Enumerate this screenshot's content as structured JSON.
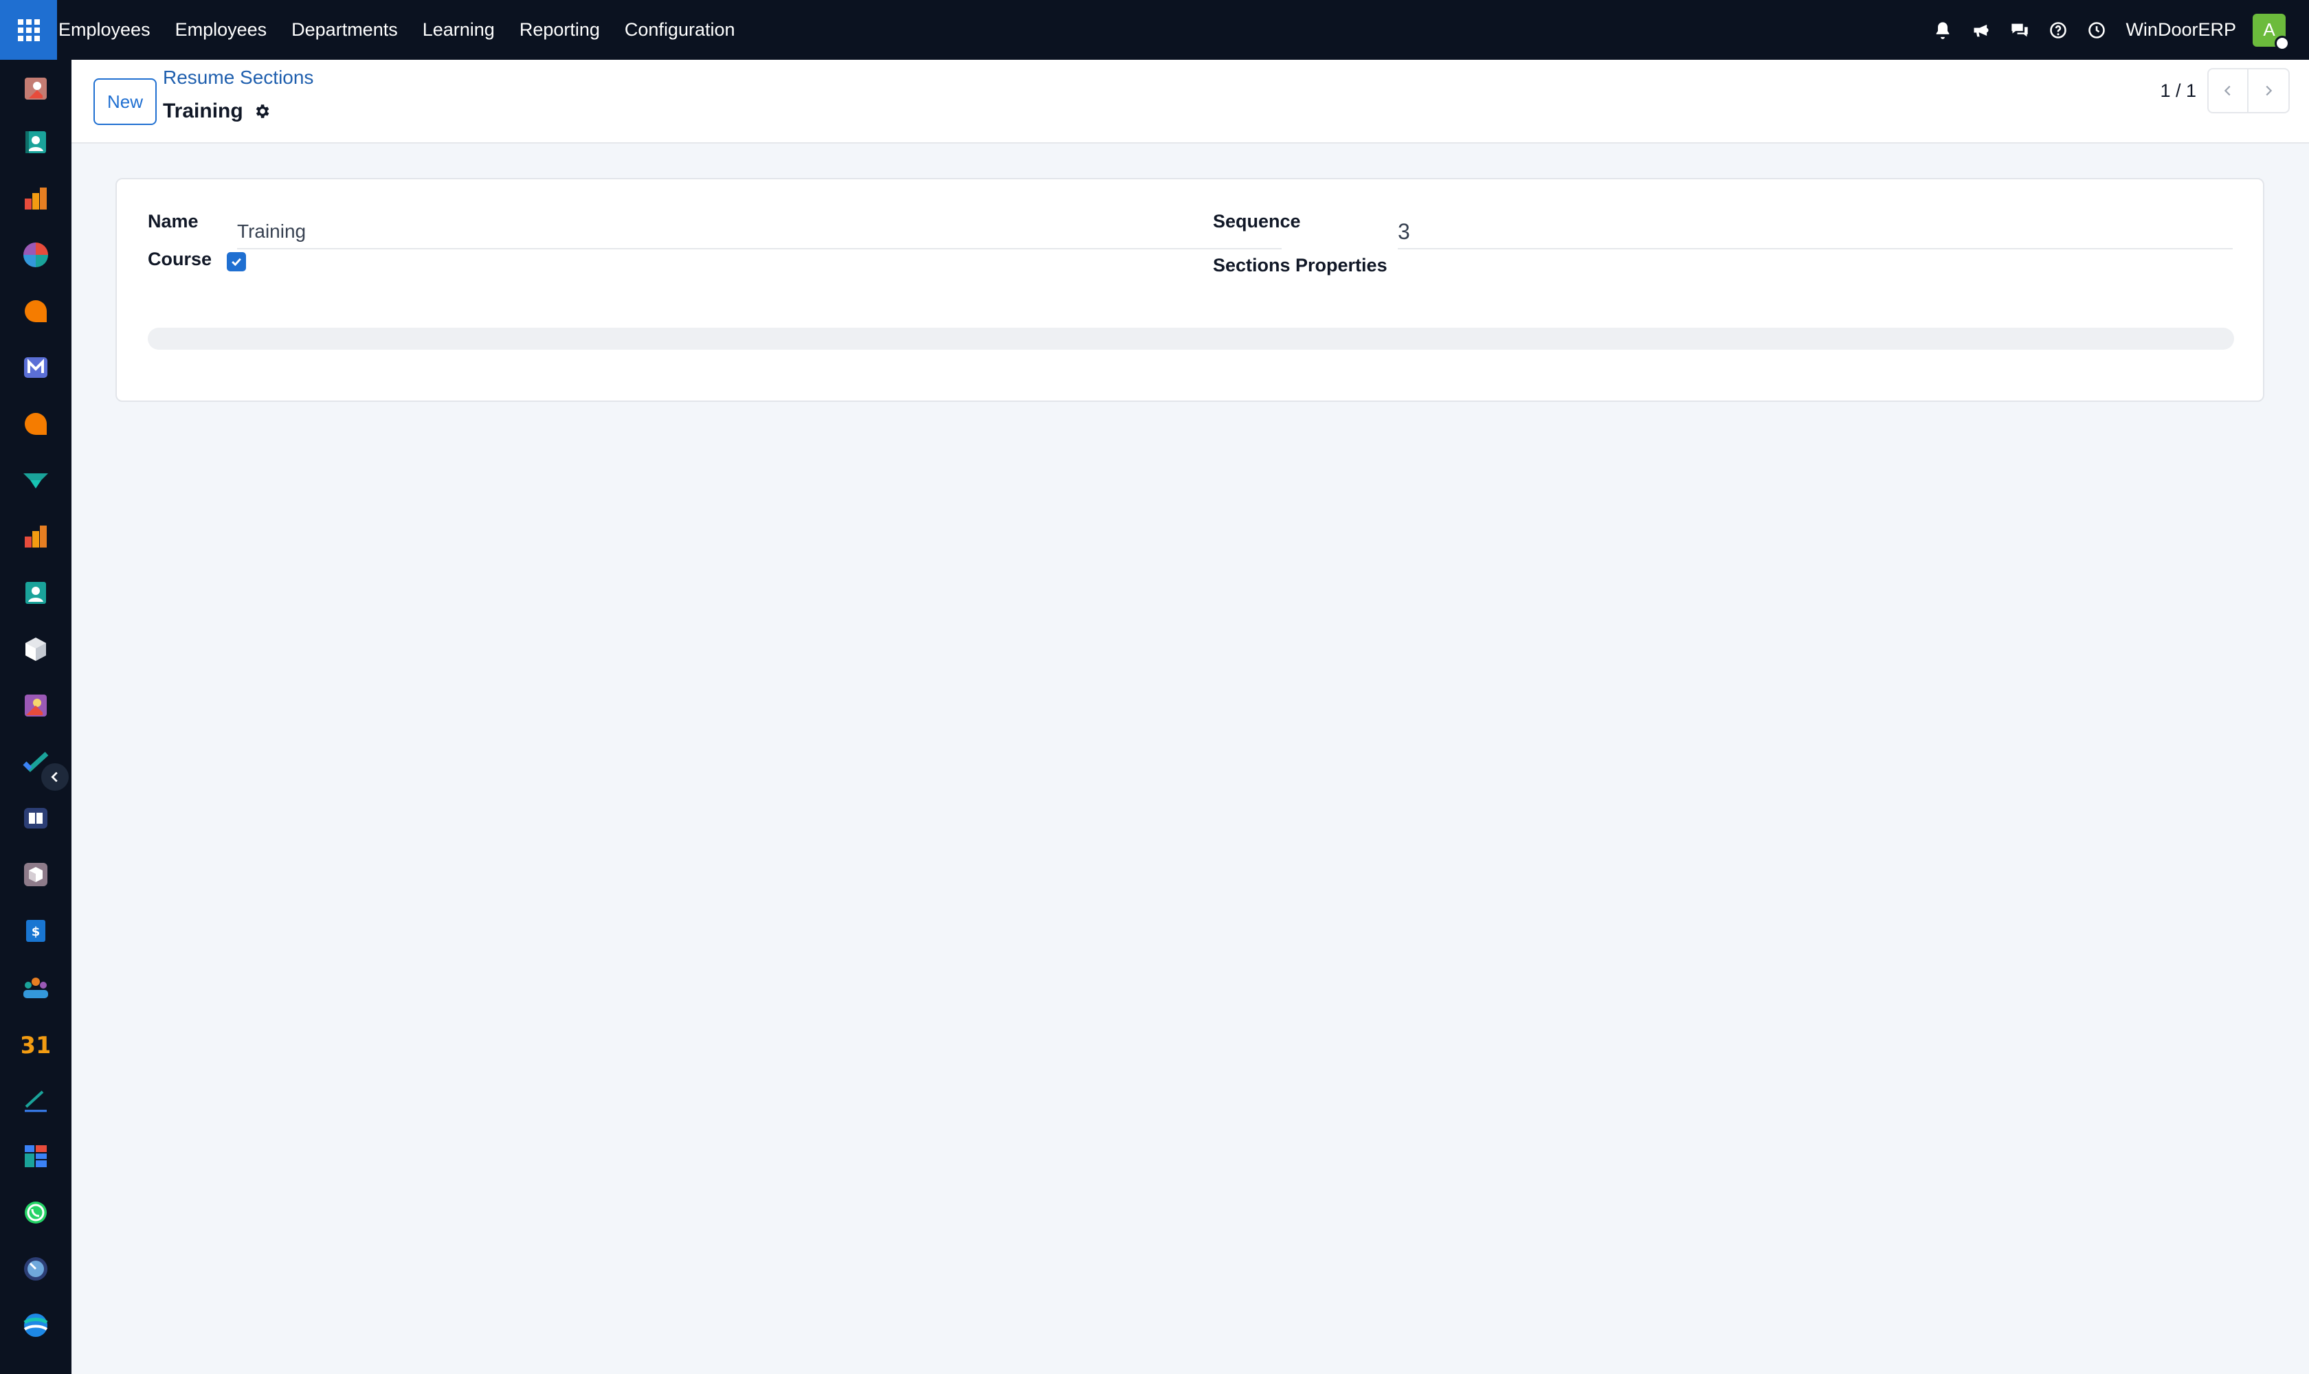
{
  "navbar": {
    "app_name": "Employees",
    "menu": [
      "Employees",
      "Departments",
      "Learning",
      "Reporting",
      "Configuration"
    ],
    "tray_icons": [
      "bell-icon",
      "megaphone-icon",
      "chat-icon",
      "help-icon",
      "clock-icon"
    ],
    "company": "WinDoorERP",
    "avatar_letter": "A",
    "avatar_color": "#6cbb3c"
  },
  "sidebar": {
    "apps": [
      "employees-app-icon",
      "contacts-app-icon",
      "reporting-app-icon",
      "dashboards-app-icon",
      "discuss-app-icon",
      "email-marketing-app-icon",
      "livechat-app-icon",
      "project-app-icon",
      "analytics-app-icon",
      "directory-app-icon",
      "inventory-app-icon",
      "employees-alt-app-icon",
      "todo-app-icon",
      "knowledge-app-icon",
      "purchase-app-icon",
      "expenses-app-icon",
      "team-app-icon",
      "calendar-app-icon",
      "sign-app-icon",
      "spreadsheet-app-icon",
      "whatsapp-app-icon",
      "time-off-app-icon",
      "website-app-icon"
    ]
  },
  "control_panel": {
    "new_label": "New",
    "breadcrumb_parent": "Resume Sections",
    "breadcrumb_current": "Training",
    "pager_value": "1 / 1"
  },
  "form": {
    "name_label": "Name",
    "name_value": "Training",
    "course_label": "Course",
    "course_checked": true,
    "sequence_label": "Sequence",
    "sequence_value": "3",
    "sections_properties_label": "Sections Properties"
  },
  "colors": {
    "navbar_bg": "#0b1220",
    "accent": "#1f6fd1",
    "page_bg": "#f3f6fa"
  }
}
